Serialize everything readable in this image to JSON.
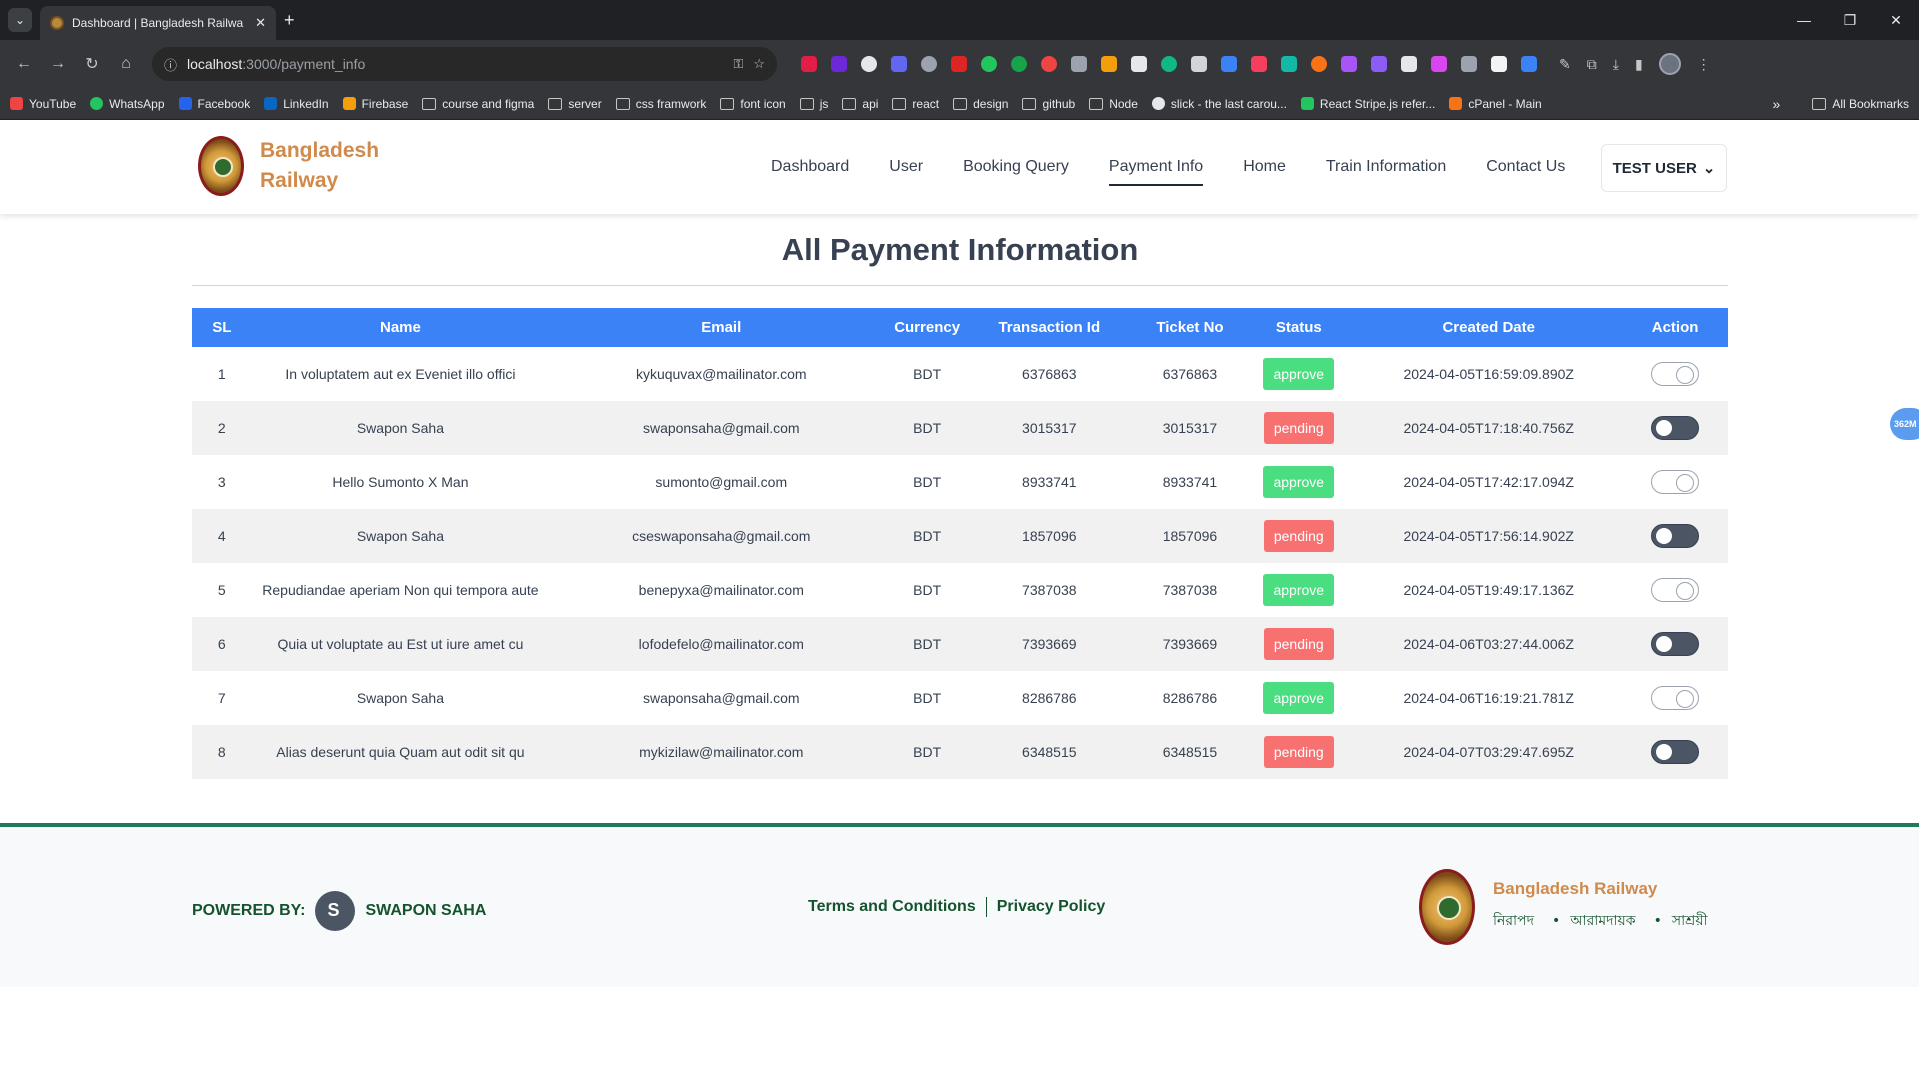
{
  "browser": {
    "tab_title": "Dashboard | Bangladesh Railwa",
    "url_host": "localhost",
    "url_path": ":3000/payment_info",
    "bookmarks": [
      "YouTube",
      "WhatsApp",
      "Facebook",
      "LinkedIn",
      "Firebase",
      "course and figma",
      "server",
      "css framwork",
      "font icon",
      "js",
      "api",
      "react",
      "design",
      "github",
      "Node",
      "slick - the last carou...",
      "React Stripe.js refer...",
      "cPanel - Main"
    ],
    "all_bookmarks": "All Bookmarks",
    "floating_badge": "362M"
  },
  "header": {
    "brand_line1": "Bangladesh",
    "brand_line2": "Railway",
    "nav": [
      "Dashboard",
      "User",
      "Booking Query",
      "Payment Info",
      "Home",
      "Train Information",
      "Contact Us"
    ],
    "active_nav": "Payment Info",
    "user_button": "TEST USER"
  },
  "main": {
    "title": "All Payment Information",
    "columns": [
      "SL",
      "Name",
      "Email",
      "Currency",
      "Transaction Id",
      "Ticket No",
      "Status",
      "Created Date",
      "Action"
    ],
    "rows": [
      {
        "sl": "1",
        "name": "In voluptatem aut ex Eveniet illo offici",
        "email": "kykuquvax@mailinator.com",
        "currency": "BDT",
        "transaction_id": "6376863",
        "ticket_no": "6376863",
        "status": "approve",
        "created": "2024-04-05T16:59:09.890Z",
        "toggle_on": true
      },
      {
        "sl": "2",
        "name": "Swapon Saha",
        "email": "swaponsaha@gmail.com",
        "currency": "BDT",
        "transaction_id": "3015317",
        "ticket_no": "3015317",
        "status": "pending",
        "created": "2024-04-05T17:18:40.756Z",
        "toggle_on": false
      },
      {
        "sl": "3",
        "name": "Hello Sumonto X Man",
        "email": "sumonto@gmail.com",
        "currency": "BDT",
        "transaction_id": "8933741",
        "ticket_no": "8933741",
        "status": "approve",
        "created": "2024-04-05T17:42:17.094Z",
        "toggle_on": true
      },
      {
        "sl": "4",
        "name": "Swapon Saha",
        "email": "cseswaponsaha@gmail.com",
        "currency": "BDT",
        "transaction_id": "1857096",
        "ticket_no": "1857096",
        "status": "pending",
        "created": "2024-04-05T17:56:14.902Z",
        "toggle_on": false
      },
      {
        "sl": "5",
        "name": "Repudiandae aperiam Non qui tempora aute",
        "email": "benepyxa@mailinator.com",
        "currency": "BDT",
        "transaction_id": "7387038",
        "ticket_no": "7387038",
        "status": "approve",
        "created": "2024-04-05T19:49:17.136Z",
        "toggle_on": true
      },
      {
        "sl": "6",
        "name": "Quia ut voluptate au Est ut iure amet cu",
        "email": "lofodefelo@mailinator.com",
        "currency": "BDT",
        "transaction_id": "7393669",
        "ticket_no": "7393669",
        "status": "pending",
        "created": "2024-04-06T03:27:44.006Z",
        "toggle_on": false
      },
      {
        "sl": "7",
        "name": "Swapon Saha",
        "email": "swaponsaha@gmail.com",
        "currency": "BDT",
        "transaction_id": "8286786",
        "ticket_no": "8286786",
        "status": "approve",
        "created": "2024-04-06T16:19:21.781Z",
        "toggle_on": true
      },
      {
        "sl": "8",
        "name": "Alias deserunt quia Quam aut odit sit qu",
        "email": "mykizilaw@mailinator.com",
        "currency": "BDT",
        "transaction_id": "6348515",
        "ticket_no": "6348515",
        "status": "pending",
        "created": "2024-04-07T03:29:47.695Z",
        "toggle_on": false
      }
    ]
  },
  "footer": {
    "powered_by": "POWERED BY:",
    "author": "SWAPON SAHA",
    "terms": "Terms and Conditions",
    "privacy": "Privacy Policy",
    "brand_name": "Bangladesh Railway",
    "taglines": [
      "নিরাপদ",
      "আরামদায়ক",
      "সাশ্রয়ী"
    ]
  },
  "colors": {
    "brand_orange": "#d08a4b",
    "table_header": "#3b82f6",
    "approve": "#4ade80",
    "pending": "#f87171",
    "footer_green": "#14532d"
  }
}
